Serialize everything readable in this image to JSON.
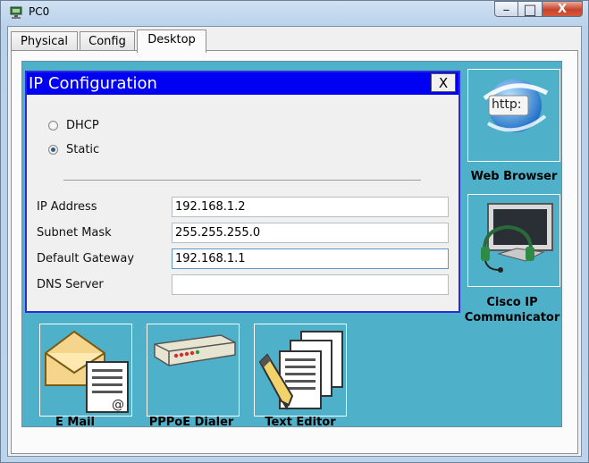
{
  "window": {
    "title": "PC0",
    "controls": {
      "minimize": "–",
      "maximize": "□",
      "close": "X"
    }
  },
  "tabs": [
    {
      "label": "Physical"
    },
    {
      "label": "Config"
    },
    {
      "label": "Desktop",
      "active": true
    }
  ],
  "desktop": {
    "apps": [
      {
        "label": "Web Browser",
        "icon": "web-browser-icon",
        "badge": "http:"
      },
      {
        "label": "Cisco IP Communicator",
        "label_line1": "Cisco IP",
        "label_line2": "Communicator",
        "icon": "ip-communicator-icon"
      },
      {
        "label": "E Mail",
        "icon": "email-icon"
      },
      {
        "label": "PPPoE Dialer",
        "icon": "pppoe-dialer-icon"
      },
      {
        "label": "Text Editor",
        "icon": "text-editor-icon"
      }
    ]
  },
  "dialog": {
    "title": "IP Configuration",
    "close_label": "X",
    "mode_options": [
      {
        "label": "DHCP",
        "selected": false
      },
      {
        "label": "Static",
        "selected": true
      }
    ],
    "fields": {
      "ip_address": {
        "label": "IP Address",
        "value": "192.168.1.2"
      },
      "subnet_mask": {
        "label": "Subnet Mask",
        "value": "255.255.255.0"
      },
      "default_gateway": {
        "label": "Default Gateway",
        "value": "192.168.1.1"
      },
      "dns_server": {
        "label": "DNS Server",
        "value": ""
      }
    }
  },
  "colors": {
    "desktop_bg": "#4fb1c9",
    "dialog_title_bg": "#0000f2",
    "dialog_title_text": "#ffffff"
  }
}
